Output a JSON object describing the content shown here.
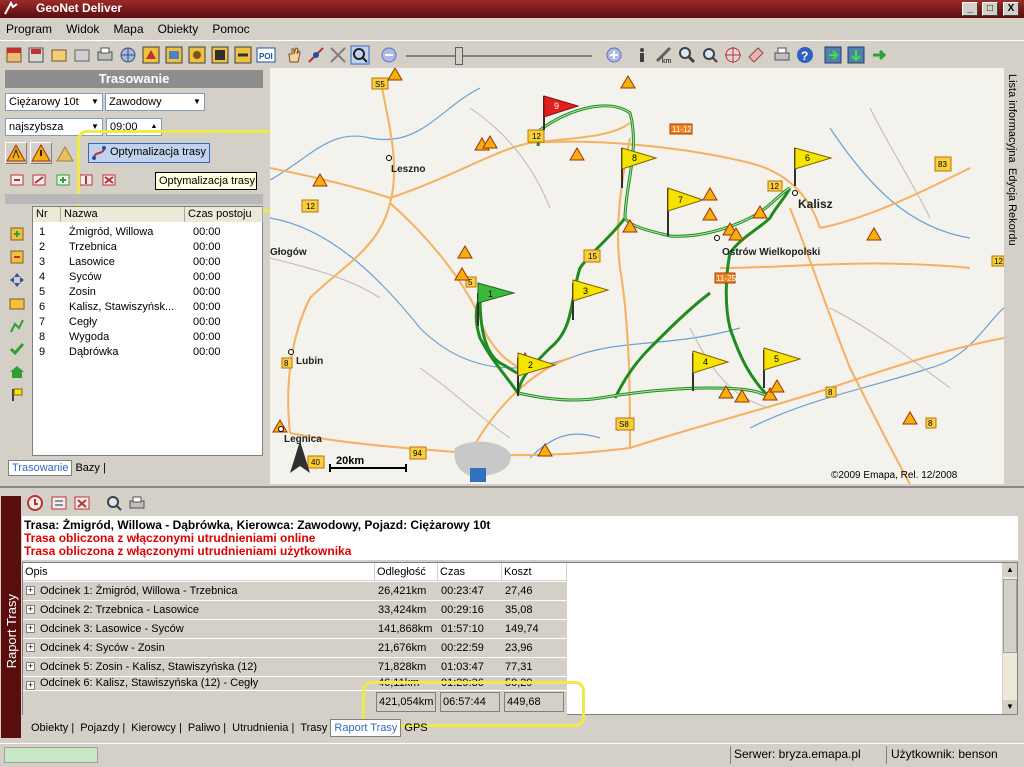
{
  "window": {
    "title": "GeoNet  Deliver",
    "min": "_",
    "max": "□",
    "close": "X"
  },
  "menu": [
    "Program",
    "Widok",
    "Mapa",
    "Obiekty",
    "Pomoc"
  ],
  "left": {
    "header": "Trasowanie",
    "vehicle": "Ciężarowy 10t",
    "driver": "Zawodowy",
    "mode": "najszybsza",
    "time": "09:00",
    "optimize_label": "Optymalizacja trasy",
    "tooltip": "Optymalizacja trasy",
    "columns": [
      "Nr",
      "Nazwa",
      "Czas postoju"
    ],
    "points": [
      {
        "nr": "1",
        "name": "Żmigród, Willowa",
        "time": "00:00"
      },
      {
        "nr": "2",
        "name": "Trzebnica",
        "time": "00:00"
      },
      {
        "nr": "3",
        "name": "Lasowice",
        "time": "00:00"
      },
      {
        "nr": "4",
        "name": "Syców",
        "time": "00:00"
      },
      {
        "nr": "5",
        "name": "Zosin",
        "time": "00:00"
      },
      {
        "nr": "6",
        "name": "Kalisz, Stawiszyńsk...",
        "time": "00:00"
      },
      {
        "nr": "7",
        "name": "Cegły",
        "time": "00:00"
      },
      {
        "nr": "8",
        "name": "Wygoda",
        "time": "00:00"
      },
      {
        "nr": "9",
        "name": "Dąbrówka",
        "time": "00:00"
      }
    ],
    "tabs": [
      "Trasowanie",
      "Bazy |"
    ]
  },
  "map": {
    "cities": [
      "Leszno",
      "Kalisz",
      "Głogów",
      "Ostrów Wielkopolski",
      "Lubin",
      "Legnica"
    ],
    "roads": [
      "S5",
      "12",
      "11-12",
      "83",
      "12",
      "5",
      "15",
      "11-25",
      "S8",
      "8",
      "40",
      "94",
      "12",
      "12",
      "8"
    ],
    "scale": "20km",
    "copyright": "©2009 Emapa,  Rel. 12/2008",
    "flags": [
      "1",
      "2",
      "3",
      "4",
      "5",
      "6",
      "7",
      "8",
      "9"
    ],
    "colors": {
      "route": "#1f8c1f",
      "flag_yellow": "#f5e400",
      "flag_green": "#3cb83c",
      "flag_red": "#e02020",
      "road": "#f5b060",
      "water": "#6aa0d8"
    }
  },
  "right_tabs": [
    "Lista informacyjna",
    "Edycja Rekordu"
  ],
  "bottom": {
    "vtab": "Raport Trasy",
    "summary": [
      "Trasa: Żmigród, Willowa - Dąbrówka, Kierowca: Zawodowy,    Pojazd: Ciężarowy 10t",
      "Trasa obliczona z włączonymi utrudnieniami online",
      "Trasa obliczona z włączonymi utrudnieniami użytkownika"
    ],
    "columns": [
      "Opis",
      "Odległość",
      "Czas",
      "Koszt"
    ],
    "rows": [
      {
        "desc": "Odcinek 1: Żmigród, Willowa - Trzebnica",
        "dist": "26,421km",
        "time": "00:23:47",
        "cost": "27,46"
      },
      {
        "desc": "Odcinek 2: Trzebnica - Lasowice",
        "dist": "33,424km",
        "time": "00:29:16",
        "cost": "35,08"
      },
      {
        "desc": "Odcinek 3: Lasowice - Syców",
        "dist": "141,868km",
        "time": "01:57:10",
        "cost": "149,74"
      },
      {
        "desc": "Odcinek 4: Syców - Zosin",
        "dist": "21,676km",
        "time": "00:22:59",
        "cost": "23,96"
      },
      {
        "desc": "Odcinek 5: Zosin - Kalisz, Stawiszyńska (12)",
        "dist": "71,828km",
        "time": "01:03:47",
        "cost": "77,31"
      },
      {
        "desc": "Odcinek 6: Kalisz, Stawiszyńska (12) - Cegły",
        "dist": "46,11km",
        "time": "01:29:36",
        "cost": "50,29"
      }
    ],
    "totals": {
      "dist": "421,054km",
      "time": "06:57:44",
      "cost": "449,68"
    },
    "tabs": [
      "Obiekty |",
      "Pojazdy |",
      "Kierowcy |",
      "Paliwo |",
      "Utrudnienia |",
      "Trasy",
      "Raport Trasy",
      "GPS"
    ]
  },
  "status": {
    "server": "Serwer: bryza.emapa.pl",
    "user": "Użytkownik: benson"
  }
}
